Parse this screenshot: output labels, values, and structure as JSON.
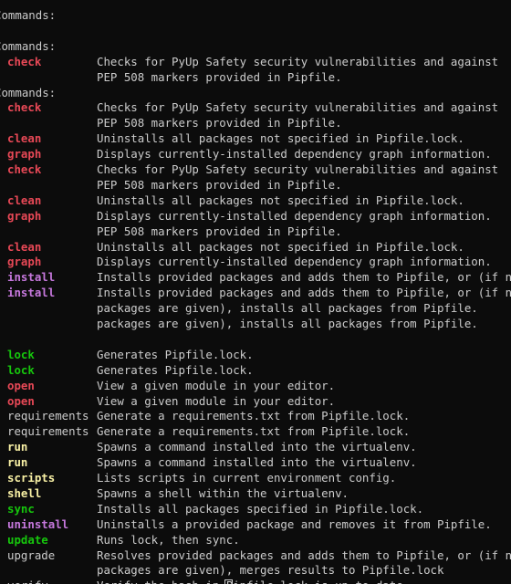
{
  "colors": {
    "background": "#0c0c0c",
    "text": "#cccccc",
    "red": "#e74856",
    "magenta": "#c678dd",
    "green": "#16c60c",
    "yellow": "#f9f1a5",
    "white": "#cccccc"
  },
  "lines": [
    {
      "type": "header",
      "text": "Commands:"
    },
    {
      "type": "blank"
    },
    {
      "type": "header",
      "text": "Commands:"
    },
    {
      "type": "cmd",
      "cmd": "check",
      "color": "red",
      "desc": "Checks for PyUp Safety security vulnerabilities and against"
    },
    {
      "type": "cont",
      "desc": "PEP 508 markers provided in Pipfile."
    },
    {
      "type": "header",
      "text": "Commands:"
    },
    {
      "type": "cmd",
      "cmd": "check",
      "color": "red",
      "desc": "Checks for PyUp Safety security vulnerabilities and against"
    },
    {
      "type": "cont",
      "desc": "PEP 508 markers provided in Pipfile."
    },
    {
      "type": "cmd",
      "cmd": "clean",
      "color": "red",
      "desc": "Uninstalls all packages not specified in Pipfile.lock."
    },
    {
      "type": "cmd",
      "cmd": "graph",
      "color": "red",
      "desc": "Displays currently-installed dependency graph information."
    },
    {
      "type": "cmd",
      "cmd": "check",
      "color": "red",
      "desc": "Checks for PyUp Safety security vulnerabilities and against"
    },
    {
      "type": "cont",
      "desc": "PEP 508 markers provided in Pipfile."
    },
    {
      "type": "cmd",
      "cmd": "clean",
      "color": "red",
      "desc": "Uninstalls all packages not specified in Pipfile.lock."
    },
    {
      "type": "cmd",
      "cmd": "graph",
      "color": "red",
      "desc": "Displays currently-installed dependency graph information."
    },
    {
      "type": "cont",
      "desc": "PEP 508 markers provided in Pipfile."
    },
    {
      "type": "cmd",
      "cmd": "clean",
      "color": "red",
      "desc": "Uninstalls all packages not specified in Pipfile.lock."
    },
    {
      "type": "cmd",
      "cmd": "graph",
      "color": "red",
      "desc": "Displays currently-installed dependency graph information."
    },
    {
      "type": "cmd",
      "cmd": "install",
      "color": "magenta",
      "desc": "Installs provided packages and adds them to Pipfile, or (if no"
    },
    {
      "type": "cmd",
      "cmd": "install",
      "color": "magenta",
      "desc": "Installs provided packages and adds them to Pipfile, or (if no"
    },
    {
      "type": "cont",
      "desc": "packages are given), installs all packages from Pipfile."
    },
    {
      "type": "cont",
      "desc": "packages are given), installs all packages from Pipfile."
    },
    {
      "type": "blank"
    },
    {
      "type": "cmd",
      "cmd": "lock",
      "color": "green",
      "desc": "Generates Pipfile.lock."
    },
    {
      "type": "cmd",
      "cmd": "lock",
      "color": "green",
      "desc": "Generates Pipfile.lock."
    },
    {
      "type": "cmd",
      "cmd": "open",
      "color": "red",
      "desc": "View a given module in your editor."
    },
    {
      "type": "cmd",
      "cmd": "open",
      "color": "red",
      "desc": "View a given module in your editor."
    },
    {
      "type": "cmd",
      "cmd": "requirements",
      "color": "white",
      "plain": true,
      "desc": "Generate a requirements.txt from Pipfile.lock."
    },
    {
      "type": "cmd",
      "cmd": "requirements",
      "color": "white",
      "plain": true,
      "desc": "Generate a requirements.txt from Pipfile.lock."
    },
    {
      "type": "cmd",
      "cmd": "run",
      "color": "yellow",
      "desc": "Spawns a command installed into the virtualenv."
    },
    {
      "type": "cmd",
      "cmd": "run",
      "color": "yellow",
      "desc": "Spawns a command installed into the virtualenv."
    },
    {
      "type": "cmd",
      "cmd": "scripts",
      "color": "yellow",
      "desc": "Lists scripts in current environment config."
    },
    {
      "type": "cmd",
      "cmd": "shell",
      "color": "yellow",
      "desc": "Spawns a shell within the virtualenv."
    },
    {
      "type": "cmd",
      "cmd": "sync",
      "color": "green",
      "desc": "Installs all packages specified in Pipfile.lock."
    },
    {
      "type": "cmd",
      "cmd": "uninstall",
      "color": "magenta",
      "desc": "Uninstalls a provided package and removes it from Pipfile."
    },
    {
      "type": "cmd",
      "cmd": "update",
      "color": "green",
      "desc": "Runs lock, then sync."
    },
    {
      "type": "cmd",
      "cmd": "upgrade",
      "color": "white",
      "plain": true,
      "desc": "Resolves provided packages and adds them to Pipfile, or (if no"
    },
    {
      "type": "cont",
      "desc": "packages are given), merges results to Pipfile.lock"
    },
    {
      "type": "cmd",
      "cmd": "verify",
      "color": "white",
      "plain": true,
      "desc": "Verify the hash in Pipfile.lock is up-to-date."
    }
  ]
}
